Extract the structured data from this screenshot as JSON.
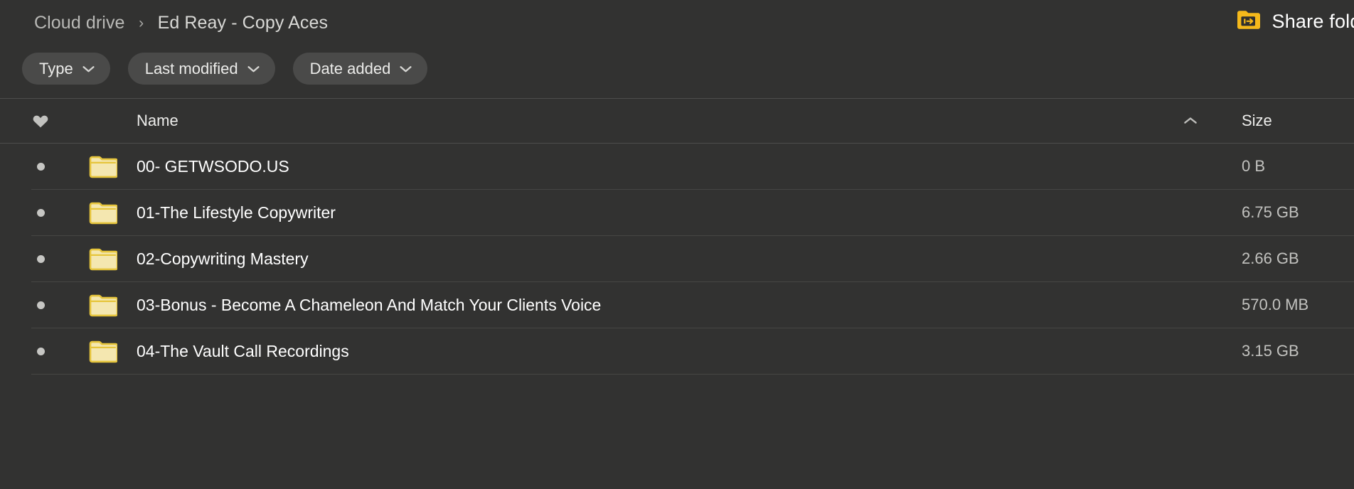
{
  "breadcrumb": {
    "root": "Cloud drive",
    "separator": "›",
    "current": "Ed Reay - Copy Aces"
  },
  "actions": {
    "share_folder_label": "Share folder",
    "share_folder_icon": "share-folder-icon"
  },
  "filters": [
    {
      "label": "Type",
      "icon": "chevron-down-icon"
    },
    {
      "label": "Last modified",
      "icon": "chevron-down-icon"
    },
    {
      "label": "Date added",
      "icon": "chevron-down-icon"
    }
  ],
  "table": {
    "columns": {
      "favorite_icon": "heart-icon",
      "name": "Name",
      "size": "Size"
    },
    "sort": {
      "column": "Name",
      "direction": "ascending",
      "icon": "chevron-up-icon"
    },
    "rows": [
      {
        "icon": "folder-icon",
        "bullet": "dot-icon",
        "name": "00- GETWSODO.US",
        "size": "0 B"
      },
      {
        "icon": "folder-icon",
        "bullet": "dot-icon",
        "name": "01-The Lifestyle Copywriter",
        "size": "6.75 GB"
      },
      {
        "icon": "folder-icon",
        "bullet": "dot-icon",
        "name": "02-Copywriting Mastery",
        "size": "2.66 GB"
      },
      {
        "icon": "folder-icon",
        "bullet": "dot-icon",
        "name": "03-Bonus - Become A Chameleon And Match Your Clients Voice",
        "size": "570.0 MB"
      },
      {
        "icon": "folder-icon",
        "bullet": "dot-icon",
        "name": "04-The Vault Call Recordings",
        "size": "3.15 GB"
      }
    ]
  },
  "colors": {
    "background": "#323231",
    "chip_background": "#4a4a49",
    "accent_amber": "#f5b91b",
    "folder_fill": "#f4e7b0",
    "folder_border": "#e6c53c",
    "divider": "#464644",
    "text_primary": "#ffffff",
    "text_secondary": "#c2c2bf",
    "text_muted": "#b9b9b6"
  }
}
